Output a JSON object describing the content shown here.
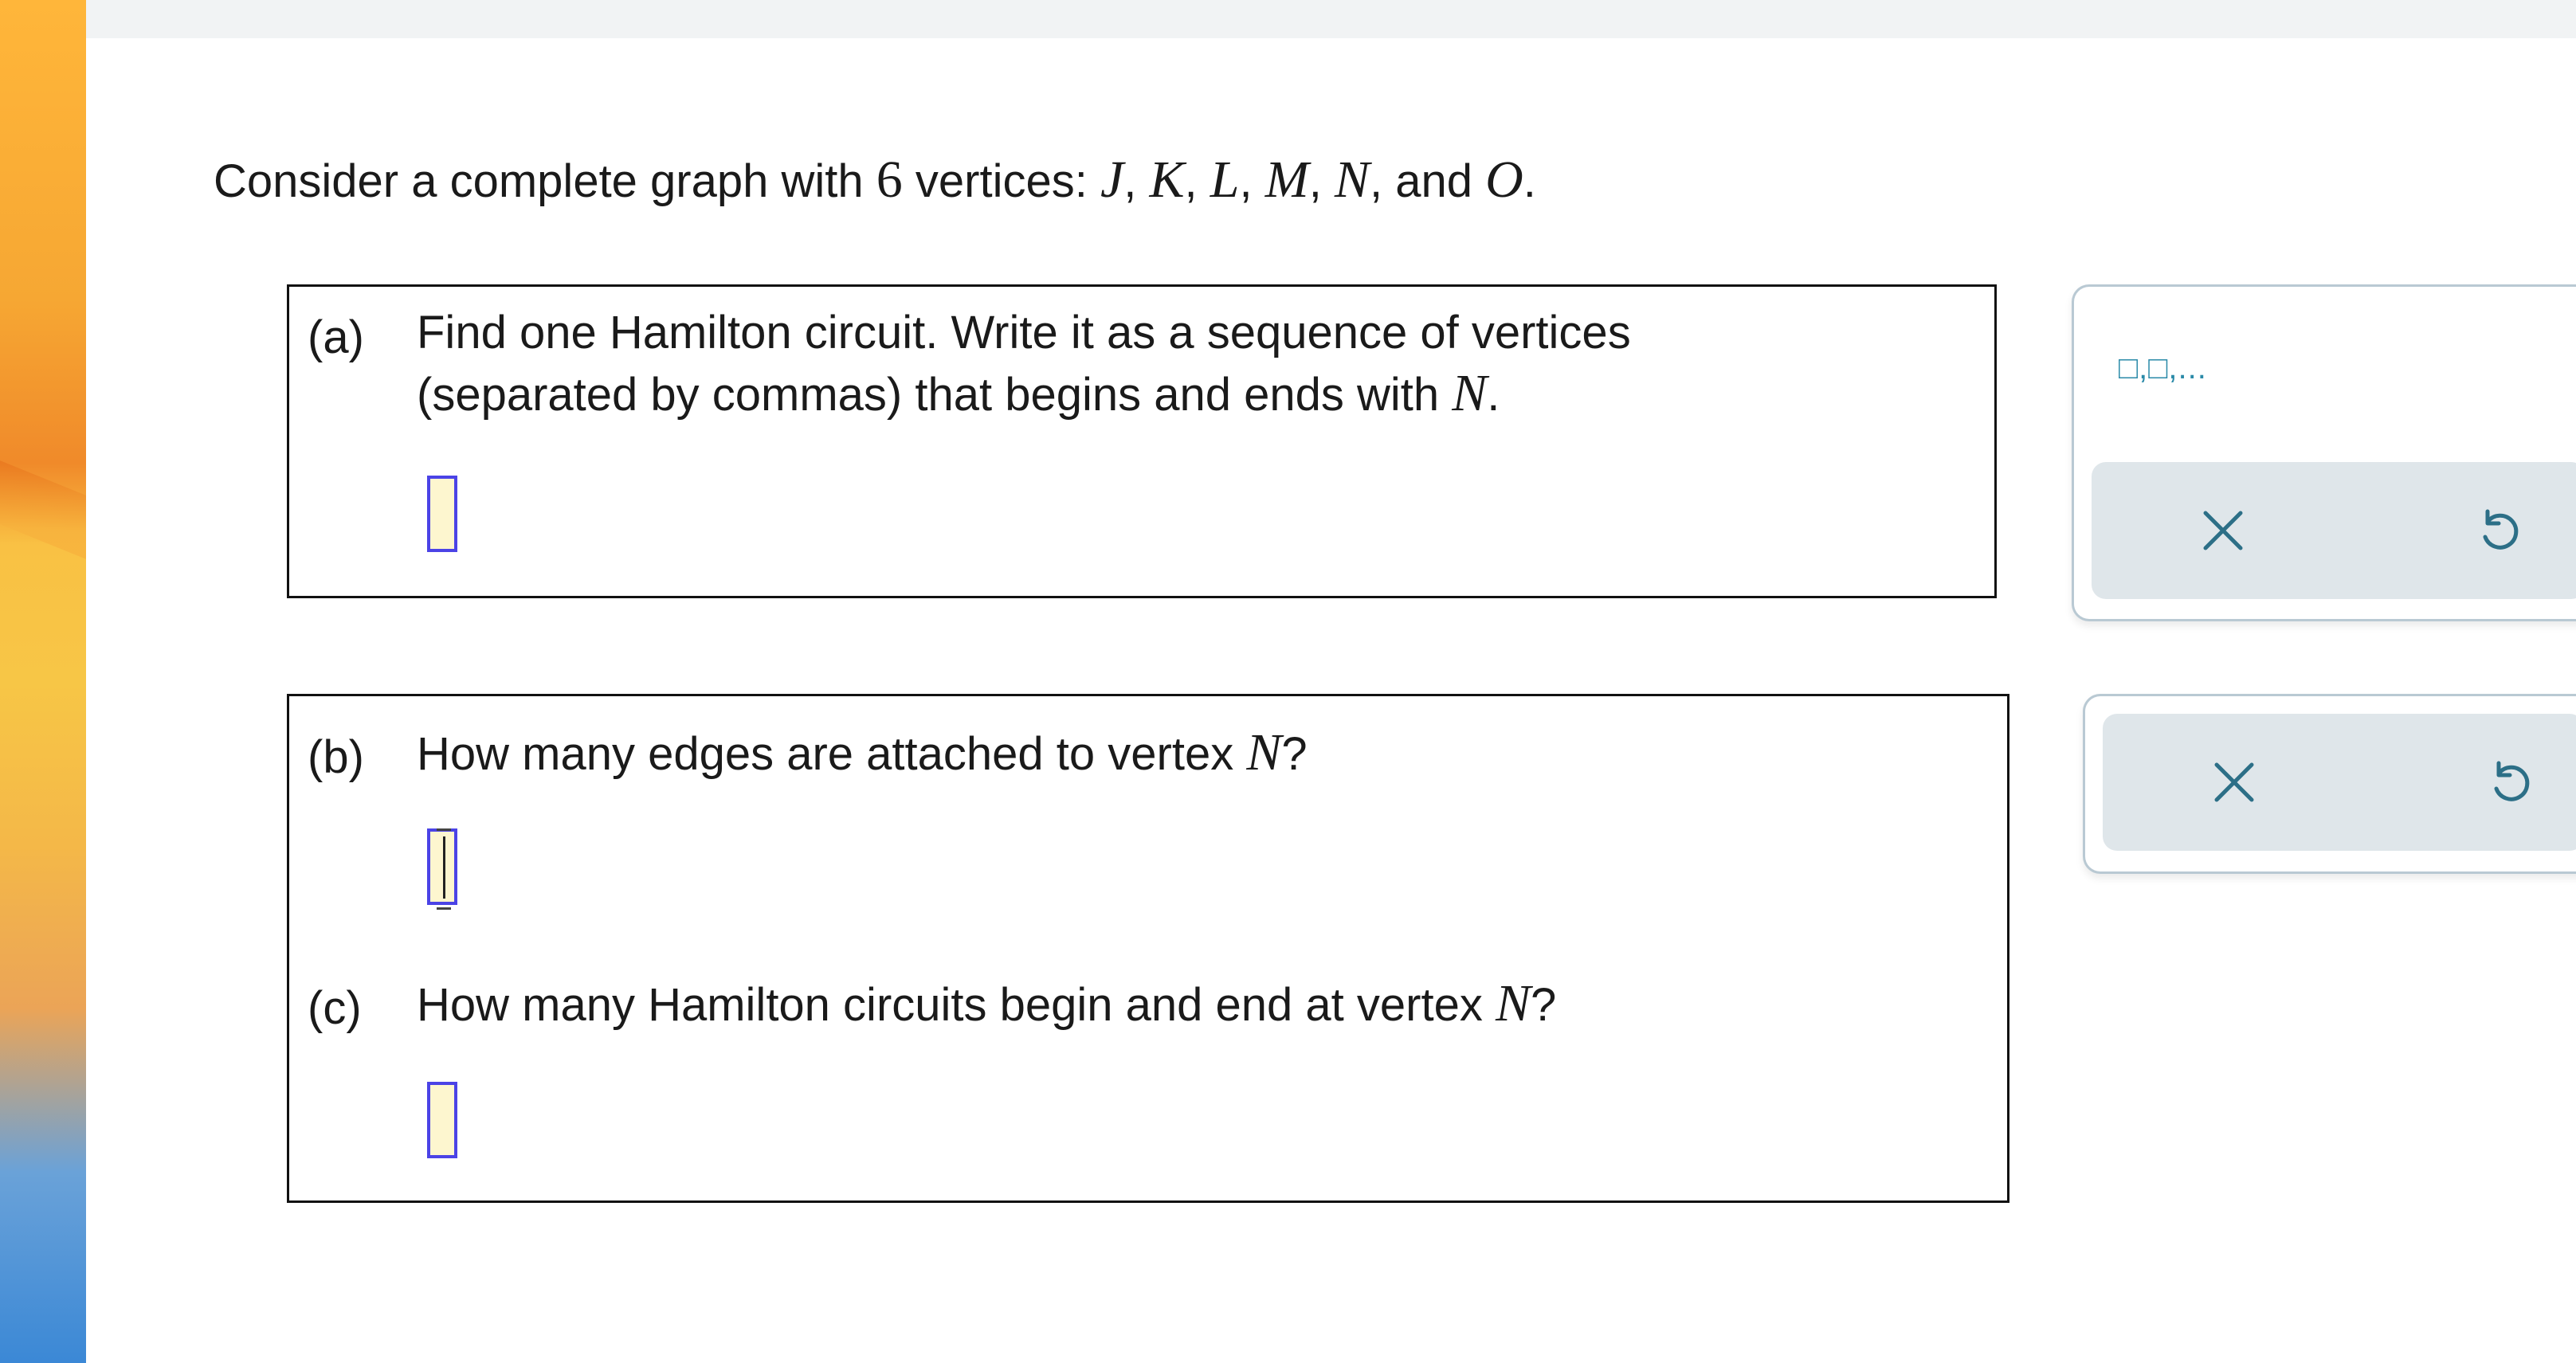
{
  "intro": {
    "prefix": "Consider a complete graph with ",
    "count": "6",
    "middle": " vertices: ",
    "vertices": [
      "J",
      "K",
      "L",
      "M",
      "N",
      "O"
    ],
    "sep": ", ",
    "conj": "and ",
    "end": "."
  },
  "part_a": {
    "label": "(a)",
    "line1": "Find one Hamilton circuit. Write it as a sequence of vertices",
    "line2_prefix": "(separated by commas) that begins and ends with ",
    "line2_var": "N",
    "line2_suffix": "."
  },
  "part_b": {
    "label": "(b)",
    "text_prefix": "How many edges are attached to vertex ",
    "text_var": "N",
    "text_suffix": "?"
  },
  "part_c": {
    "label": "(c)",
    "text_prefix": "How many Hamilton circuits begin and end at vertex ",
    "text_var": "N",
    "text_suffix": "?"
  },
  "tools": {
    "sequence_template": "□,□,...",
    "clear_icon": "close-icon",
    "undo_icon": "undo-icon",
    "accent": "#2a8aa8",
    "icon_color": "#2c6f87"
  }
}
